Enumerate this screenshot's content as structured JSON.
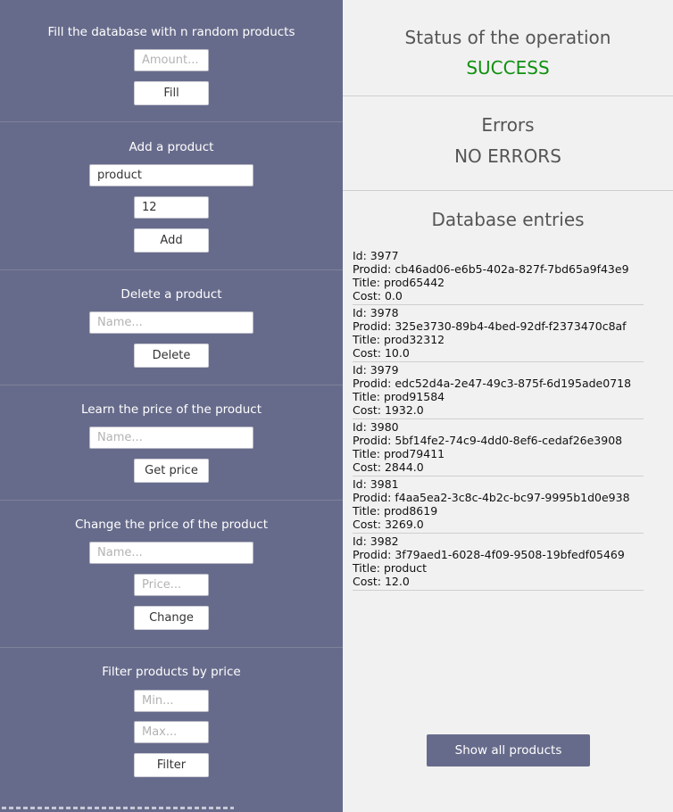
{
  "fill": {
    "title": "Fill the database with n random products",
    "amount_placeholder": "Amount...",
    "button": "Fill"
  },
  "add": {
    "title": "Add a product",
    "name_value": "product",
    "price_value": "12",
    "button": "Add"
  },
  "delete": {
    "title": "Delete a product",
    "name_placeholder": "Name...",
    "button": "Delete"
  },
  "learn": {
    "title": "Learn the price of the product",
    "name_placeholder": "Name...",
    "button": "Get price"
  },
  "change": {
    "title": "Change the price of the product",
    "name_placeholder": "Name...",
    "price_placeholder": "Price...",
    "button": "Change"
  },
  "filter": {
    "title": "Filter products by price",
    "min_placeholder": "Min...",
    "max_placeholder": "Max...",
    "button": "Filter"
  },
  "status": {
    "title": "Status of the operation",
    "value": "SUCCESS",
    "value_color": "#109010"
  },
  "errors": {
    "title": "Errors",
    "value": "NO ERRORS"
  },
  "database": {
    "title": "Database entries",
    "entries": [
      {
        "id": "Id: 3977",
        "prodid": "Prodid: cb46ad06-e6b5-402a-827f-7bd65a9f43e9",
        "title": "Title: prod65442",
        "cost": "Cost: 0.0"
      },
      {
        "id": "Id: 3978",
        "prodid": "Prodid: 325e3730-89b4-4bed-92df-f2373470c8af",
        "title": "Title: prod32312",
        "cost": "Cost: 10.0"
      },
      {
        "id": "Id: 3979",
        "prodid": "Prodid: edc52d4a-2e47-49c3-875f-6d195ade0718",
        "title": "Title: prod91584",
        "cost": "Cost: 1932.0"
      },
      {
        "id": "Id: 3980",
        "prodid": "Prodid: 5bf14fe2-74c9-4dd0-8ef6-cedaf26e3908",
        "title": "Title: prod79411",
        "cost": "Cost: 2844.0"
      },
      {
        "id": "Id: 3981",
        "prodid": "Prodid: f4aa5ea2-3c8c-4b2c-bc97-9995b1d0e938",
        "title": "Title: prod8619",
        "cost": "Cost: 3269.0"
      },
      {
        "id": "Id: 3982",
        "prodid": "Prodid: 3f79aed1-6028-4f09-9508-19bfedf05469",
        "title": "Title: product",
        "cost": "Cost: 12.0"
      }
    ],
    "show_all_button": "Show all products"
  },
  "colors": {
    "panel": "#676b8b",
    "success": "#109010",
    "background": "#f1f1f1"
  }
}
